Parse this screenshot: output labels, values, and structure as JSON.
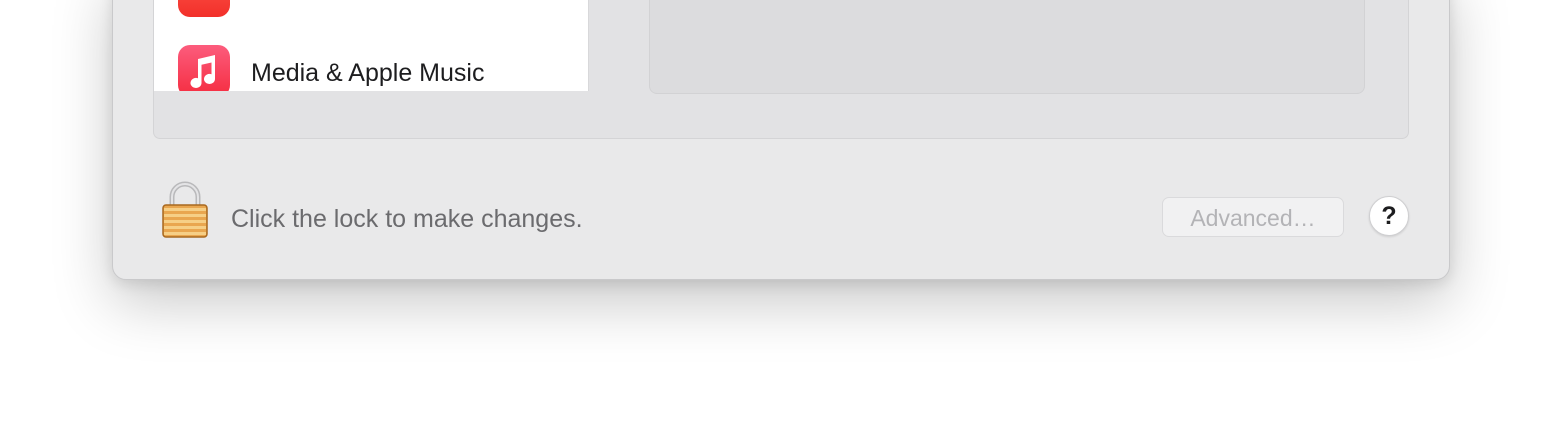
{
  "app_list": {
    "items": [
      {
        "label": "",
        "icon": "red-app-icon",
        "color": "#f2302a"
      },
      {
        "label": "Media & Apple Music",
        "icon": "music-note-icon",
        "color": "#f52c3f"
      }
    ]
  },
  "footer": {
    "lock_text": "Click the lock to make changes.",
    "advanced_label": "Advanced…",
    "help_label": "?"
  },
  "colors": {
    "window_background": "#e9e9ea",
    "list_background": "#ffffff",
    "disabled_text": "#b3b3b6"
  }
}
